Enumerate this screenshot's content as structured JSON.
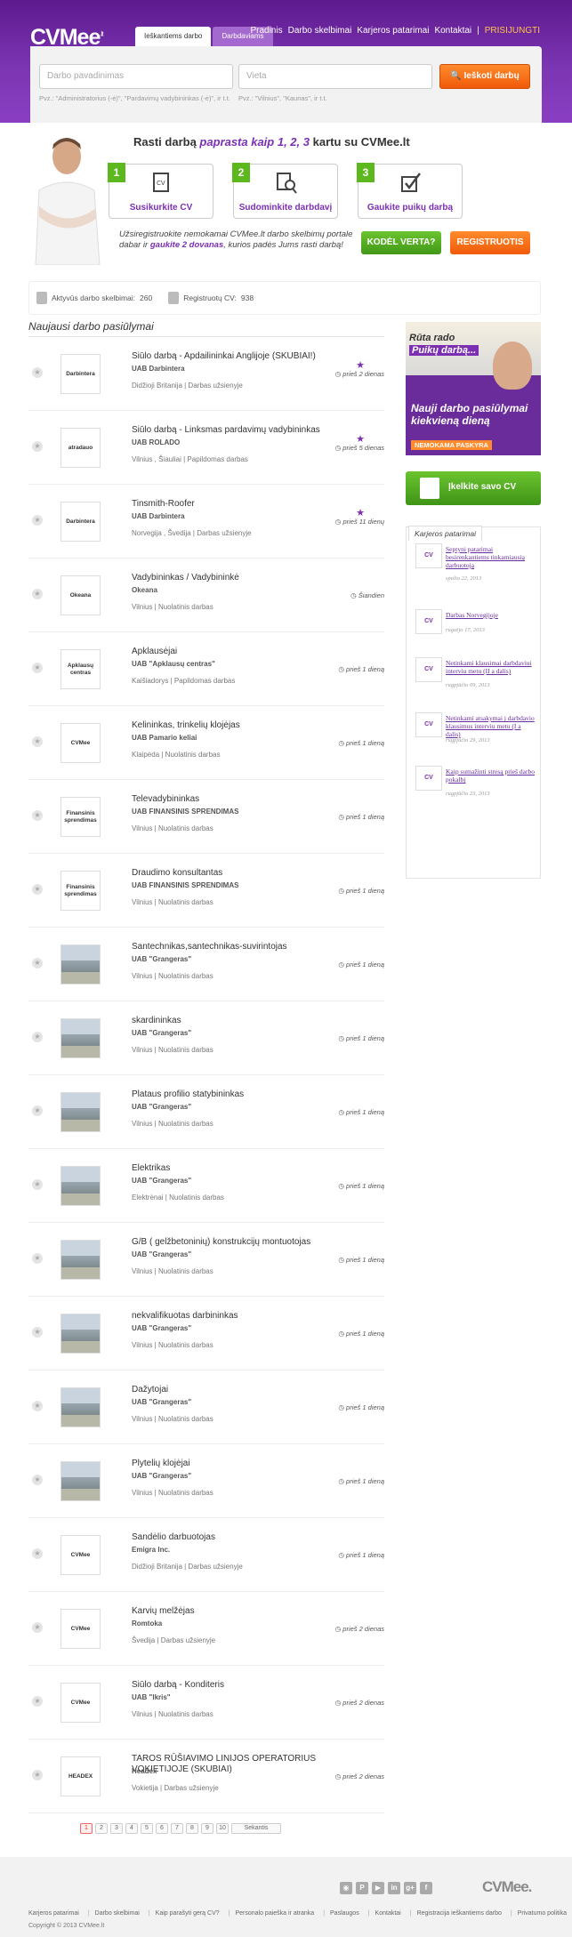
{
  "header": {
    "logo": "CVMee",
    "logo_suffix": ".lt",
    "tabs": [
      "Ieškantiems darbo",
      "Darbdaviams"
    ],
    "nav": [
      "Pradinis",
      "Darbo skelbimai",
      "Karjeros patarimai",
      "Kontaktai",
      "|",
      "PRISIJUNGTI"
    ]
  },
  "search": {
    "job_placeholder": "Darbo pavadinimas",
    "job_hint": "Pvz.: \"Administratorius (-ė)\", \"Pardavimų vadybininkas (-ė)\", ir t.t.",
    "location_placeholder": "Vieta",
    "location_hint": "Pvz.: \"Vilnius\", \"Kaunas\", ir t.t.",
    "button": "Ieškoti darbų"
  },
  "hero": {
    "title_pre": "Rasti darbą ",
    "title_em": "paprasta kaip 1, 2, 3",
    "title_post": " kartu su CVMee.lt",
    "steps": [
      {
        "num": "1",
        "label": "Susikurkite CV"
      },
      {
        "num": "2",
        "label": "Sudominkite darbdavį"
      },
      {
        "num": "3",
        "label": "Gaukite puikų darbą"
      }
    ],
    "text_pre": "Užsiregistruokite nemokamai CVMee.lt darbo skelbimų portale dabar ir ",
    "text_bold": "gaukite 2 dovanas",
    "text_post": ", kurios padės Jums rasti darbą!",
    "btn_why": "KODĖL VERTA?",
    "btn_register": "REGISTRUOTIS"
  },
  "stats": {
    "active_label": "Aktyvūs darbo skelbimai:",
    "active_value": "260",
    "cv_label": "Registruotų CV:",
    "cv_value": "938"
  },
  "section_title": "Naujausi darbo pasiūlymai",
  "jobs": [
    {
      "title": "Siūlo darbą - Apdailininkai Anglijoje (SKUBIAI!)",
      "company": "UAB Darbintera",
      "location": "Didžioji Britanija | Darbas užsienyje",
      "time": "prieš 2 dienas",
      "logo": "Darbintera",
      "star": true
    },
    {
      "title": "Siūlo darbą - Linksmas pardavimų vadybininkas",
      "company": "UAB ROLADO",
      "location": "Vilnius , Šiauliai | Papildomas darbas",
      "time": "prieš 5 dienas",
      "logo": "atradauo",
      "star": true
    },
    {
      "title": "Tinsmith-Roofer",
      "company": "UAB Darbintera",
      "location": "Norvegija , Švedija | Darbas užsienyje",
      "time": "prieš 11 dienų",
      "logo": "Darbintera",
      "star": true
    },
    {
      "title": "Vadybininkas / Vadybininkė",
      "company": "Okeana",
      "location": "Vilnius | Nuolatinis darbas",
      "time": "Šiandien",
      "logo": "Okeana",
      "star": false
    },
    {
      "title": "Apklausėjai",
      "company": "UAB \"Apklausų centras\"",
      "location": "Kaišiadorys | Papildomas darbas",
      "time": "prieš 1 dieną",
      "logo": "Apklausų centras",
      "star": false
    },
    {
      "title": "Kelininkas, trinkelių klojėjas",
      "company": "UAB Pamario keliai",
      "location": "Klaipėda | Nuolatinis darbas",
      "time": "prieš 1 dieną",
      "logo": "CVMee",
      "star": false
    },
    {
      "title": "Televadybininkas",
      "company": "UAB FINANSINIS SPRENDIMAS",
      "location": "Vilnius | Nuolatinis darbas",
      "time": "prieš 1 dieną",
      "logo": "Finansinis sprendimas",
      "star": false
    },
    {
      "title": "Draudimo konsultantas",
      "company": "UAB FINANSINIS SPRENDIMAS",
      "location": "Vilnius | Nuolatinis darbas",
      "time": "prieš 1 dieną",
      "logo": "Finansinis sprendimas",
      "star": false
    },
    {
      "title": "Santechnikas,santechnikas-suvirintojas",
      "company": "UAB \"Grangeras\"",
      "location": "Vilnius | Nuolatinis darbas",
      "time": "prieš 1 dieną",
      "logo": "",
      "star": false
    },
    {
      "title": "skardininkas",
      "company": "UAB \"Grangeras\"",
      "location": "Vilnius | Nuolatinis darbas",
      "time": "prieš 1 dieną",
      "logo": "",
      "star": false
    },
    {
      "title": "Plataus profilio statybininkas",
      "company": "UAB \"Grangeras\"",
      "location": "Vilnius | Nuolatinis darbas",
      "time": "prieš 1 dieną",
      "logo": "",
      "star": false
    },
    {
      "title": "Elektrikas",
      "company": "UAB \"Grangeras\"",
      "location": "Elektrėnai | Nuolatinis darbas",
      "time": "prieš 1 dieną",
      "logo": "",
      "star": false
    },
    {
      "title": "G/B ( gelžbetoninių) konstrukcijų montuotojas",
      "company": "UAB \"Grangeras\"",
      "location": "Vilnius | Nuolatinis darbas",
      "time": "prieš 1 dieną",
      "logo": "",
      "star": false
    },
    {
      "title": "nekvalifikuotas darbininkas",
      "company": "UAB \"Grangeras\"",
      "location": "Vilnius | Nuolatinis darbas",
      "time": "prieš 1 dieną",
      "logo": "",
      "star": false
    },
    {
      "title": "Dažytojai",
      "company": "UAB \"Grangeras\"",
      "location": "Vilnius | Nuolatinis darbas",
      "time": "prieš 1 dieną",
      "logo": "",
      "star": false
    },
    {
      "title": "Plytelių klojėjai",
      "company": "UAB \"Grangeras\"",
      "location": "Vilnius | Nuolatinis darbas",
      "time": "prieš 1 dieną",
      "logo": "",
      "star": false
    },
    {
      "title": "Sandėlio darbuotojas",
      "company": "Emigra Inc.",
      "location": "Didžioji Britanija | Darbas užsienyje",
      "time": "prieš 1 dieną",
      "logo": "CVMee",
      "star": false
    },
    {
      "title": "Karvių melžėjas",
      "company": "Romtoka",
      "location": "Švedija | Darbas užsienyje",
      "time": "prieš 2 dienas",
      "logo": "CVMee",
      "star": false
    },
    {
      "title": "Siūlo darbą - Konditeris",
      "company": "UAB \"Ikris\"",
      "location": "Vilnius | Nuolatinis darbas",
      "time": "prieš 2 dienas",
      "logo": "CVMee",
      "star": false
    },
    {
      "title": "TAROS RŪŠIAVIMO LINIJOS OPERATORIUS VOKIETIJOJE (SKUBIAI)",
      "company": "Headex",
      "location": "Vokietija | Darbas užsienyje",
      "time": "prieš 2 dienas",
      "logo": "HEADEX",
      "star": false
    }
  ],
  "pagination": [
    "1",
    "2",
    "3",
    "4",
    "5",
    "6",
    "7",
    "8",
    "9",
    "10",
    "Sekantis"
  ],
  "sidebar": {
    "ad_line1": "Rūta rado",
    "ad_line2": "Puikų darbą...",
    "ad_line3": "Nauji darbo pasiūlymai kiekvieną dieną",
    "ad_line4": "NEMOKAMA PASKYRA",
    "upload_cv": "Įkelkite savo CV",
    "tips_tab": "Karjeros patarimai",
    "tips": [
      {
        "title": "Septyni patarimai besirenkantiems tinkamiausią darbuotoją",
        "date": "spalio 22, 2013"
      },
      {
        "title": "Darbas Norvegijoje",
        "date": "rugsėjo 17, 2013"
      },
      {
        "title": "Netinkami klausimai darbdaviui interviu metu (II a dalis)",
        "date": "rugpjūčio 09, 2013"
      },
      {
        "title": "Netinkami atsakymai į darbdavio klausimus interviu metu (I a dalis)",
        "date": "rugpjūčio 29, 2013"
      },
      {
        "title": "Kaip sumažinti stresą prieš darbo pokalbį",
        "date": "rugpjūčio 23, 2013"
      }
    ]
  },
  "footer": {
    "links": [
      "Karjeros patarimai",
      "Darbo skelbimai",
      "Kaip parašyti gerą CV?",
      "Personalo paieška ir atranka",
      "Paslaugos",
      "Kontaktai",
      "Registracija ieškantiems darbo",
      "Privatumo politika"
    ],
    "copyright": "Copyright © 2013 CVMee.lt",
    "logo": "CVMee.",
    "social": [
      "rss",
      "pinterest",
      "youtube",
      "linkedin",
      "google-plus",
      "facebook"
    ]
  }
}
